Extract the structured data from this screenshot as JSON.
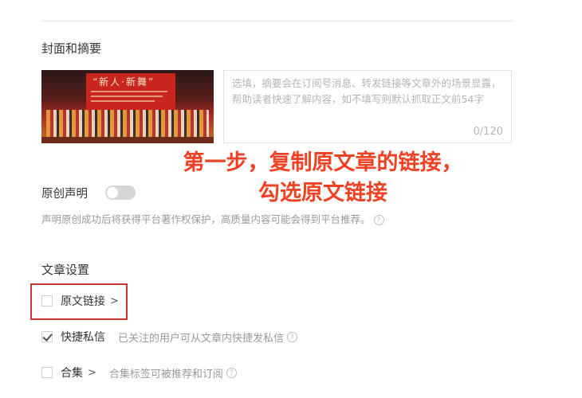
{
  "cover_section": {
    "title": "封面和摘要",
    "image_alt": "stage group photo",
    "summary_placeholder": "选填，摘要会在订阅号消息、转发链接等文章外的场景显露，帮助读者快速了解内容，如不填写则默认抓取正文前54字",
    "summary_count": "0/120"
  },
  "annotation": {
    "line1": "第一步，复制原文章的链接，",
    "line2": "勾选原文链接",
    "color": "#ef4124"
  },
  "original_declaration": {
    "label": "原创声明",
    "enabled": false,
    "description": "声明原创成功后将获得平台著作权保护，高质量内容可能会得到平台推荐。"
  },
  "article_settings": {
    "title": "文章设置",
    "options": [
      {
        "label": "原文链接",
        "checked": false,
        "chevron": ">",
        "description": ""
      },
      {
        "label": "快捷私信",
        "checked": true,
        "chevron": "",
        "description": "已关注的用户可从文章内快捷发私信"
      },
      {
        "label": "合集",
        "checked": false,
        "chevron": ">",
        "description": "合集标签可被推荐和订阅"
      }
    ]
  }
}
